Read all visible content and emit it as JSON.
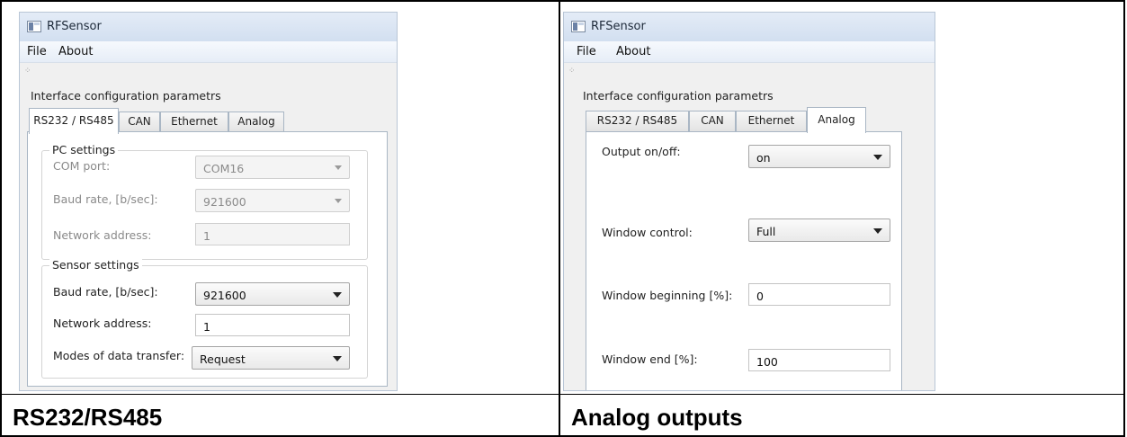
{
  "left_window": {
    "title": "RFSensor",
    "menu": [
      "File",
      "About"
    ],
    "panel_caption": "Interface configuration parametrs",
    "tabs": [
      "RS232 / RS485",
      "CAN",
      "Ethernet",
      "Analog"
    ],
    "active_tab": "RS232 / RS485",
    "pc_settings": {
      "title": "PC settings",
      "com_port_label": "COM port:",
      "com_port_value": "COM16",
      "baud_label": "Baud rate, [b/sec]:",
      "baud_value": "921600",
      "address_label": "Network address:",
      "address_value": "1"
    },
    "sensor_settings": {
      "title": "Sensor settings",
      "baud_label": "Baud rate, [b/sec]:",
      "baud_value": "921600",
      "address_label": "Network address:",
      "address_value": "1",
      "mode_label": "Modes of data transfer:",
      "mode_value": "Request"
    }
  },
  "right_window": {
    "title": "RFSensor",
    "menu": [
      "File",
      "About"
    ],
    "panel_caption": "Interface configuration parametrs",
    "tabs": [
      "RS232 / RS485",
      "CAN",
      "Ethernet",
      "Analog"
    ],
    "active_tab": "Analog",
    "analog": {
      "output_label": "Output on/off:",
      "output_value": "on",
      "window_control_label": "Window control:",
      "window_control_value": "Full",
      "window_begin_label": "Window beginning [%]:",
      "window_begin_value": "0",
      "window_end_label": "Window end [%]:",
      "window_end_value": "100"
    }
  },
  "captions": {
    "left": "RS232/RS485",
    "right": "Analog outputs"
  },
  "icons": {
    "app_icon": "rfsensor-app-icon",
    "dropdown": "chevron-down-icon"
  },
  "colors": {
    "titlebar": "#d2dff0",
    "window_bg": "#f0f0f0",
    "tab_border": "#a9b6c4",
    "disabled_text": "#8a8a8a"
  }
}
